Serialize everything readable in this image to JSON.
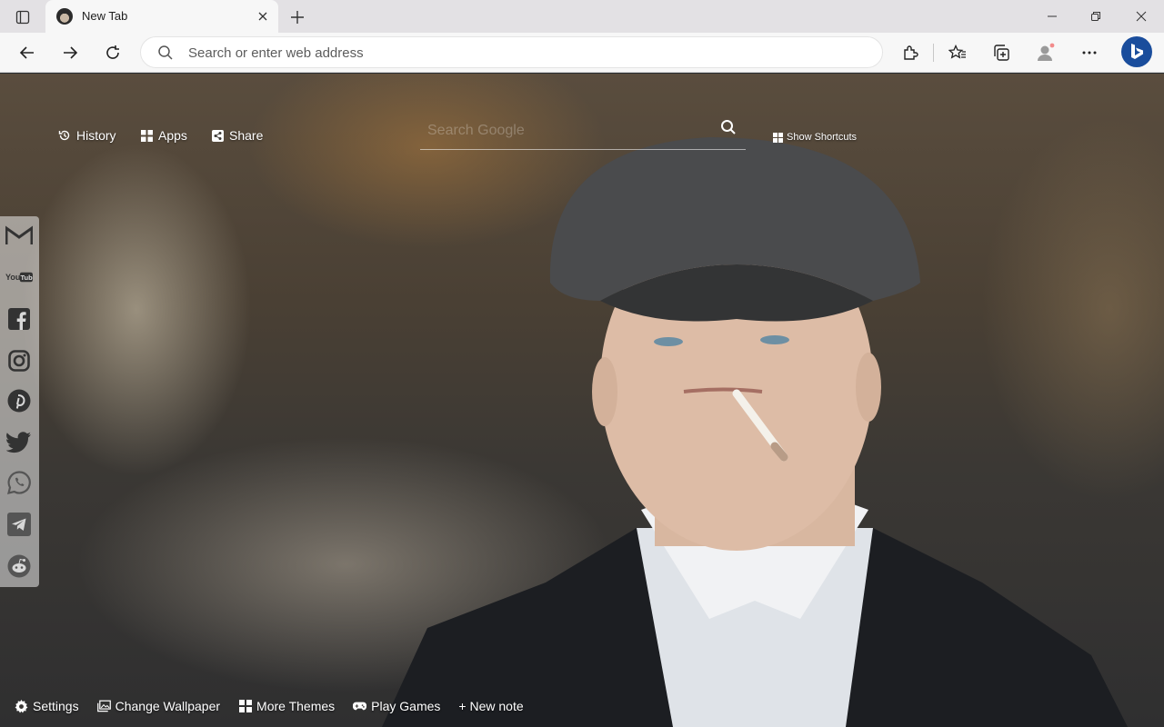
{
  "browser": {
    "tab": {
      "title": "New Tab"
    },
    "address_bar": {
      "placeholder": "Search or enter web address"
    },
    "icons": {
      "tab_actions": "tab-actions-icon",
      "favicon": "avatar-favicon",
      "close": "close-icon",
      "new_tab": "plus-icon",
      "minimize": "minimize-icon",
      "restore": "restore-icon",
      "window_close": "close-icon",
      "back": "back-arrow-icon",
      "forward": "forward-arrow-icon",
      "refresh": "refresh-icon",
      "search": "search-icon",
      "extensions": "puzzle-icon",
      "favorites": "star-list-icon",
      "collections": "collections-icon",
      "profile": "profile-icon",
      "more": "ellipsis-icon",
      "bing": "bing-icon"
    }
  },
  "newtab": {
    "nav": {
      "history": "History",
      "apps": "Apps",
      "share": "Share"
    },
    "search": {
      "placeholder": "Search Google"
    },
    "show_shortcuts": "Show Shortcuts",
    "social": [
      "gmail",
      "youtube",
      "facebook",
      "instagram",
      "pinterest",
      "twitter",
      "whatsapp",
      "telegram",
      "reddit"
    ],
    "bottom": {
      "settings": "Settings",
      "change_wallpaper": "Change Wallpaper",
      "more_themes": "More Themes",
      "play_games": "Play Games",
      "new_note": "+ New note"
    }
  },
  "colors": {
    "tabbar_bg": "#e3e1e4",
    "toolbar_bg": "#f7f7f7",
    "accent": "#1a4d9c",
    "text_on_wallpaper": "#ffffff"
  }
}
